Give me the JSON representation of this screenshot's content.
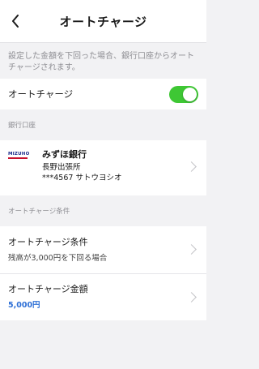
{
  "header": {
    "title": "オートチャージ"
  },
  "description": "設定した金額を下回った場合、銀行口座からオートチャージされます。",
  "auto_charge": {
    "label": "オートチャージ",
    "enabled": true,
    "toggle_color": "#3ec734"
  },
  "bank_section": {
    "label": "銀行口座"
  },
  "bank": {
    "logo_text": "MIZUHO",
    "name": "みずほ銀行",
    "branch": "長野出張所",
    "account": "***4567 サトウヨシオ"
  },
  "conditions_section": {
    "label": "オートチャージ条件"
  },
  "settings": [
    {
      "title": "オートチャージ条件",
      "value": "残高が3,000円を下回る場合"
    },
    {
      "title": "オートチャージ金額",
      "value": "5,000円"
    }
  ],
  "colors": {
    "accent": "#2d6fd6",
    "background": "#f2f2f4"
  }
}
